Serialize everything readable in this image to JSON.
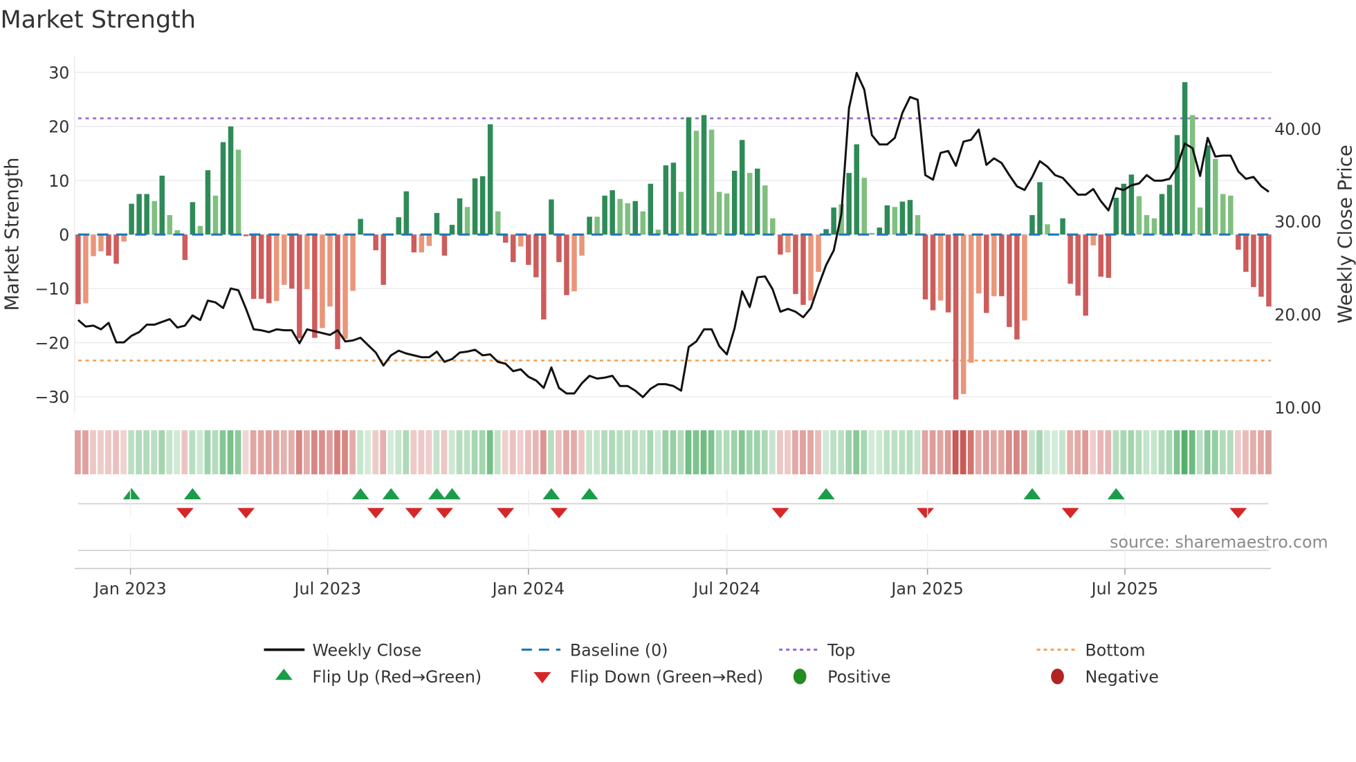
{
  "chart_data": {
    "type": "bar+line",
    "title": "Market Strength",
    "ylabel_left": "Market Strength",
    "ylabel_right": "Weekly Close Price",
    "source": "source: sharemaestro.com",
    "frequency": "weekly",
    "start_date": "2022-11-14",
    "ylim_left": [
      -33,
      33
    ],
    "ylim_right": [
      9.4,
      47.8
    ],
    "left_ticks": [
      "30",
      "20",
      "10",
      "0",
      "−10",
      "−20",
      "−30"
    ],
    "left_tick_values": [
      30,
      20,
      10,
      0,
      -10,
      -20,
      -30
    ],
    "right_ticks": [
      "40.00",
      "30.00",
      "20.00",
      "10.00"
    ],
    "right_tick_values": [
      40,
      30,
      20,
      10
    ],
    "x_ticks": [
      {
        "label": "Jan 2023",
        "date": "2023-01-01"
      },
      {
        "label": "Jul 2023",
        "date": "2023-07-01"
      },
      {
        "label": "Jan 2024",
        "date": "2024-01-01"
      },
      {
        "label": "Jul 2024",
        "date": "2024-07-01"
      },
      {
        "label": "Jan 2025",
        "date": "2025-01-01"
      },
      {
        "label": "Jul 2025",
        "date": "2025-07-01"
      }
    ],
    "top_level": 21.5,
    "bottom_level": -23.3,
    "baseline": 0,
    "strength": [
      -12.9,
      -12.7,
      -4.0,
      -3.1,
      -3.9,
      -5.4,
      -1.3,
      5.7,
      7.5,
      7.5,
      6.2,
      10.9,
      3.6,
      0.8,
      -4.7,
      6.0,
      1.6,
      11.9,
      7.2,
      17.1,
      20.0,
      15.7,
      -0.3,
      -11.9,
      -11.9,
      -12.7,
      -12.3,
      -9.3,
      -10.0,
      -19.2,
      -10.1,
      -19.1,
      -17.3,
      -13.3,
      -21.2,
      -19.3,
      -10.4,
      2.9,
      0,
      -2.9,
      -9.3,
      0.2,
      3.2,
      8.0,
      -3.3,
      -3.3,
      -2.1,
      4.0,
      -3.9,
      1.8,
      6.7,
      5.1,
      10.4,
      10.8,
      20.4,
      4.3,
      -1.5,
      -5.1,
      -2.2,
      -5.6,
      -7.9,
      -15.7,
      6.5,
      -5.1,
      -11.2,
      -10.5,
      -3.9,
      3.3,
      3.3,
      7.2,
      8.2,
      6.6,
      5.8,
      6.2,
      4.3,
      9.4,
      0.9,
      12.8,
      13.3,
      7.9,
      21.7,
      19.2,
      22.1,
      19.4,
      7.9,
      7.6,
      11.8,
      17.5,
      11.4,
      12.2,
      9.1,
      3.0,
      -3.7,
      -3.3,
      -11.0,
      -13.0,
      -12.2,
      -6.9,
      1.0,
      5.0,
      5.6,
      11.4,
      16.7,
      10.5,
      0.3,
      1.3,
      5.4,
      5.1,
      6.1,
      6.4,
      3.6,
      -12.0,
      -14.0,
      -12.2,
      -14.4,
      -30.5,
      -29.5,
      -23.7,
      -10.9,
      -14.5,
      -11.4,
      -11.4,
      -17.1,
      -19.4,
      -15.9,
      3.6,
      9.7,
      1.9,
      0,
      3.0,
      -9.1,
      -11.3,
      -15.0,
      -2.0,
      -7.8,
      -8.0,
      6.8,
      9.4,
      11.1,
      7.1,
      3.6,
      3.0,
      7.5,
      9.2,
      18.4,
      28.2,
      22.1,
      5.0,
      16.5,
      14.0,
      7.5,
      7.2,
      -2.8,
      -6.9,
      -9.7,
      -11.5,
      -13.3
    ],
    "strength_shade": "dlllddldddldllddldlddlddddllddldlldllddddldddllddddldddlddlddddddlldlddlldldlddldldlllddldlldlddlldd lddllddldd lddlddllldldddlddldddddldddddlllddddlldlllddddd",
    "weekly_close": [
      19.4,
      18.7,
      18.8,
      18.4,
      19.1,
      17.0,
      17.0,
      17.7,
      18.1,
      18.9,
      18.9,
      19.2,
      19.5,
      18.6,
      18.8,
      19.9,
      19.4,
      21.5,
      21.3,
      20.7,
      22.8,
      22.6,
      20.6,
      18.4,
      18.3,
      18.1,
      18.4,
      18.3,
      18.3,
      16.9,
      18.4,
      18.2,
      18.0,
      17.8,
      18.3,
      17.1,
      17.2,
      17.5,
      16.7,
      15.9,
      14.5,
      15.6,
      16.1,
      15.8,
      15.6,
      15.4,
      15.4,
      16.0,
      14.9,
      15.2,
      15.9,
      16.0,
      16.2,
      15.6,
      15.7,
      14.9,
      14.7,
      13.9,
      14.1,
      13.3,
      12.9,
      12.1,
      14.3,
      12.1,
      11.5,
      11.5,
      12.6,
      13.4,
      13.1,
      13.2,
      13.4,
      12.3,
      12.3,
      11.8,
      11.1,
      12.0,
      12.5,
      12.5,
      12.3,
      11.8,
      16.5,
      17.1,
      18.4,
      18.4,
      16.6,
      15.7,
      18.5,
      22.5,
      20.8,
      24.0,
      24.1,
      22.7,
      20.3,
      20.6,
      20.3,
      19.7,
      20.7,
      23.1,
      25.3,
      26.9,
      30.8,
      42.2,
      46.0,
      44.2,
      39.3,
      38.3,
      38.3,
      39.0,
      41.7,
      43.4,
      43.1,
      35.0,
      34.5,
      37.4,
      37.6,
      36.0,
      38.6,
      38.8,
      39.9,
      36.1,
      36.8,
      36.3,
      35.0,
      33.8,
      33.4,
      34.8,
      36.5,
      35.9,
      35.0,
      34.7,
      33.8,
      32.9,
      32.9,
      33.5,
      32.2,
      31.2,
      33.6,
      33.4,
      33.9,
      34.1,
      35.0,
      34.4,
      34.4,
      34.6,
      35.9,
      38.4,
      37.9,
      34.9,
      39.0,
      37.0,
      37.1,
      37.1,
      35.4,
      34.6,
      34.8,
      33.8,
      33.2
    ],
    "flip_up_week_index": [
      7,
      15,
      37,
      41,
      47,
      49,
      62,
      67,
      98,
      125,
      136
    ],
    "flip_down_week_index": [
      14,
      22,
      39,
      44,
      48,
      56,
      63,
      92,
      111,
      130,
      152
    ],
    "colors": {
      "pos_strong": "#2e8b57",
      "pos_weak": "#7fbf7f",
      "neg_strong": "#cd5c5c",
      "neg_weak": "#e9967a",
      "line": "#111111",
      "baseline": "#1f77b4",
      "top": "#9b6ad6",
      "bottom": "#f2a55e",
      "flip_up": "#1a9c48",
      "flip_down": "#d62728",
      "positive": "#228b22",
      "negative": "#b22222"
    },
    "legend": {
      "position": "bottom-center",
      "items": [
        "Weekly Close",
        "Baseline (0)",
        "Top",
        "Bottom",
        "Flip Up (Red→Green)",
        "Flip Down (Green→Red)",
        "Positive",
        "Negative"
      ]
    }
  }
}
